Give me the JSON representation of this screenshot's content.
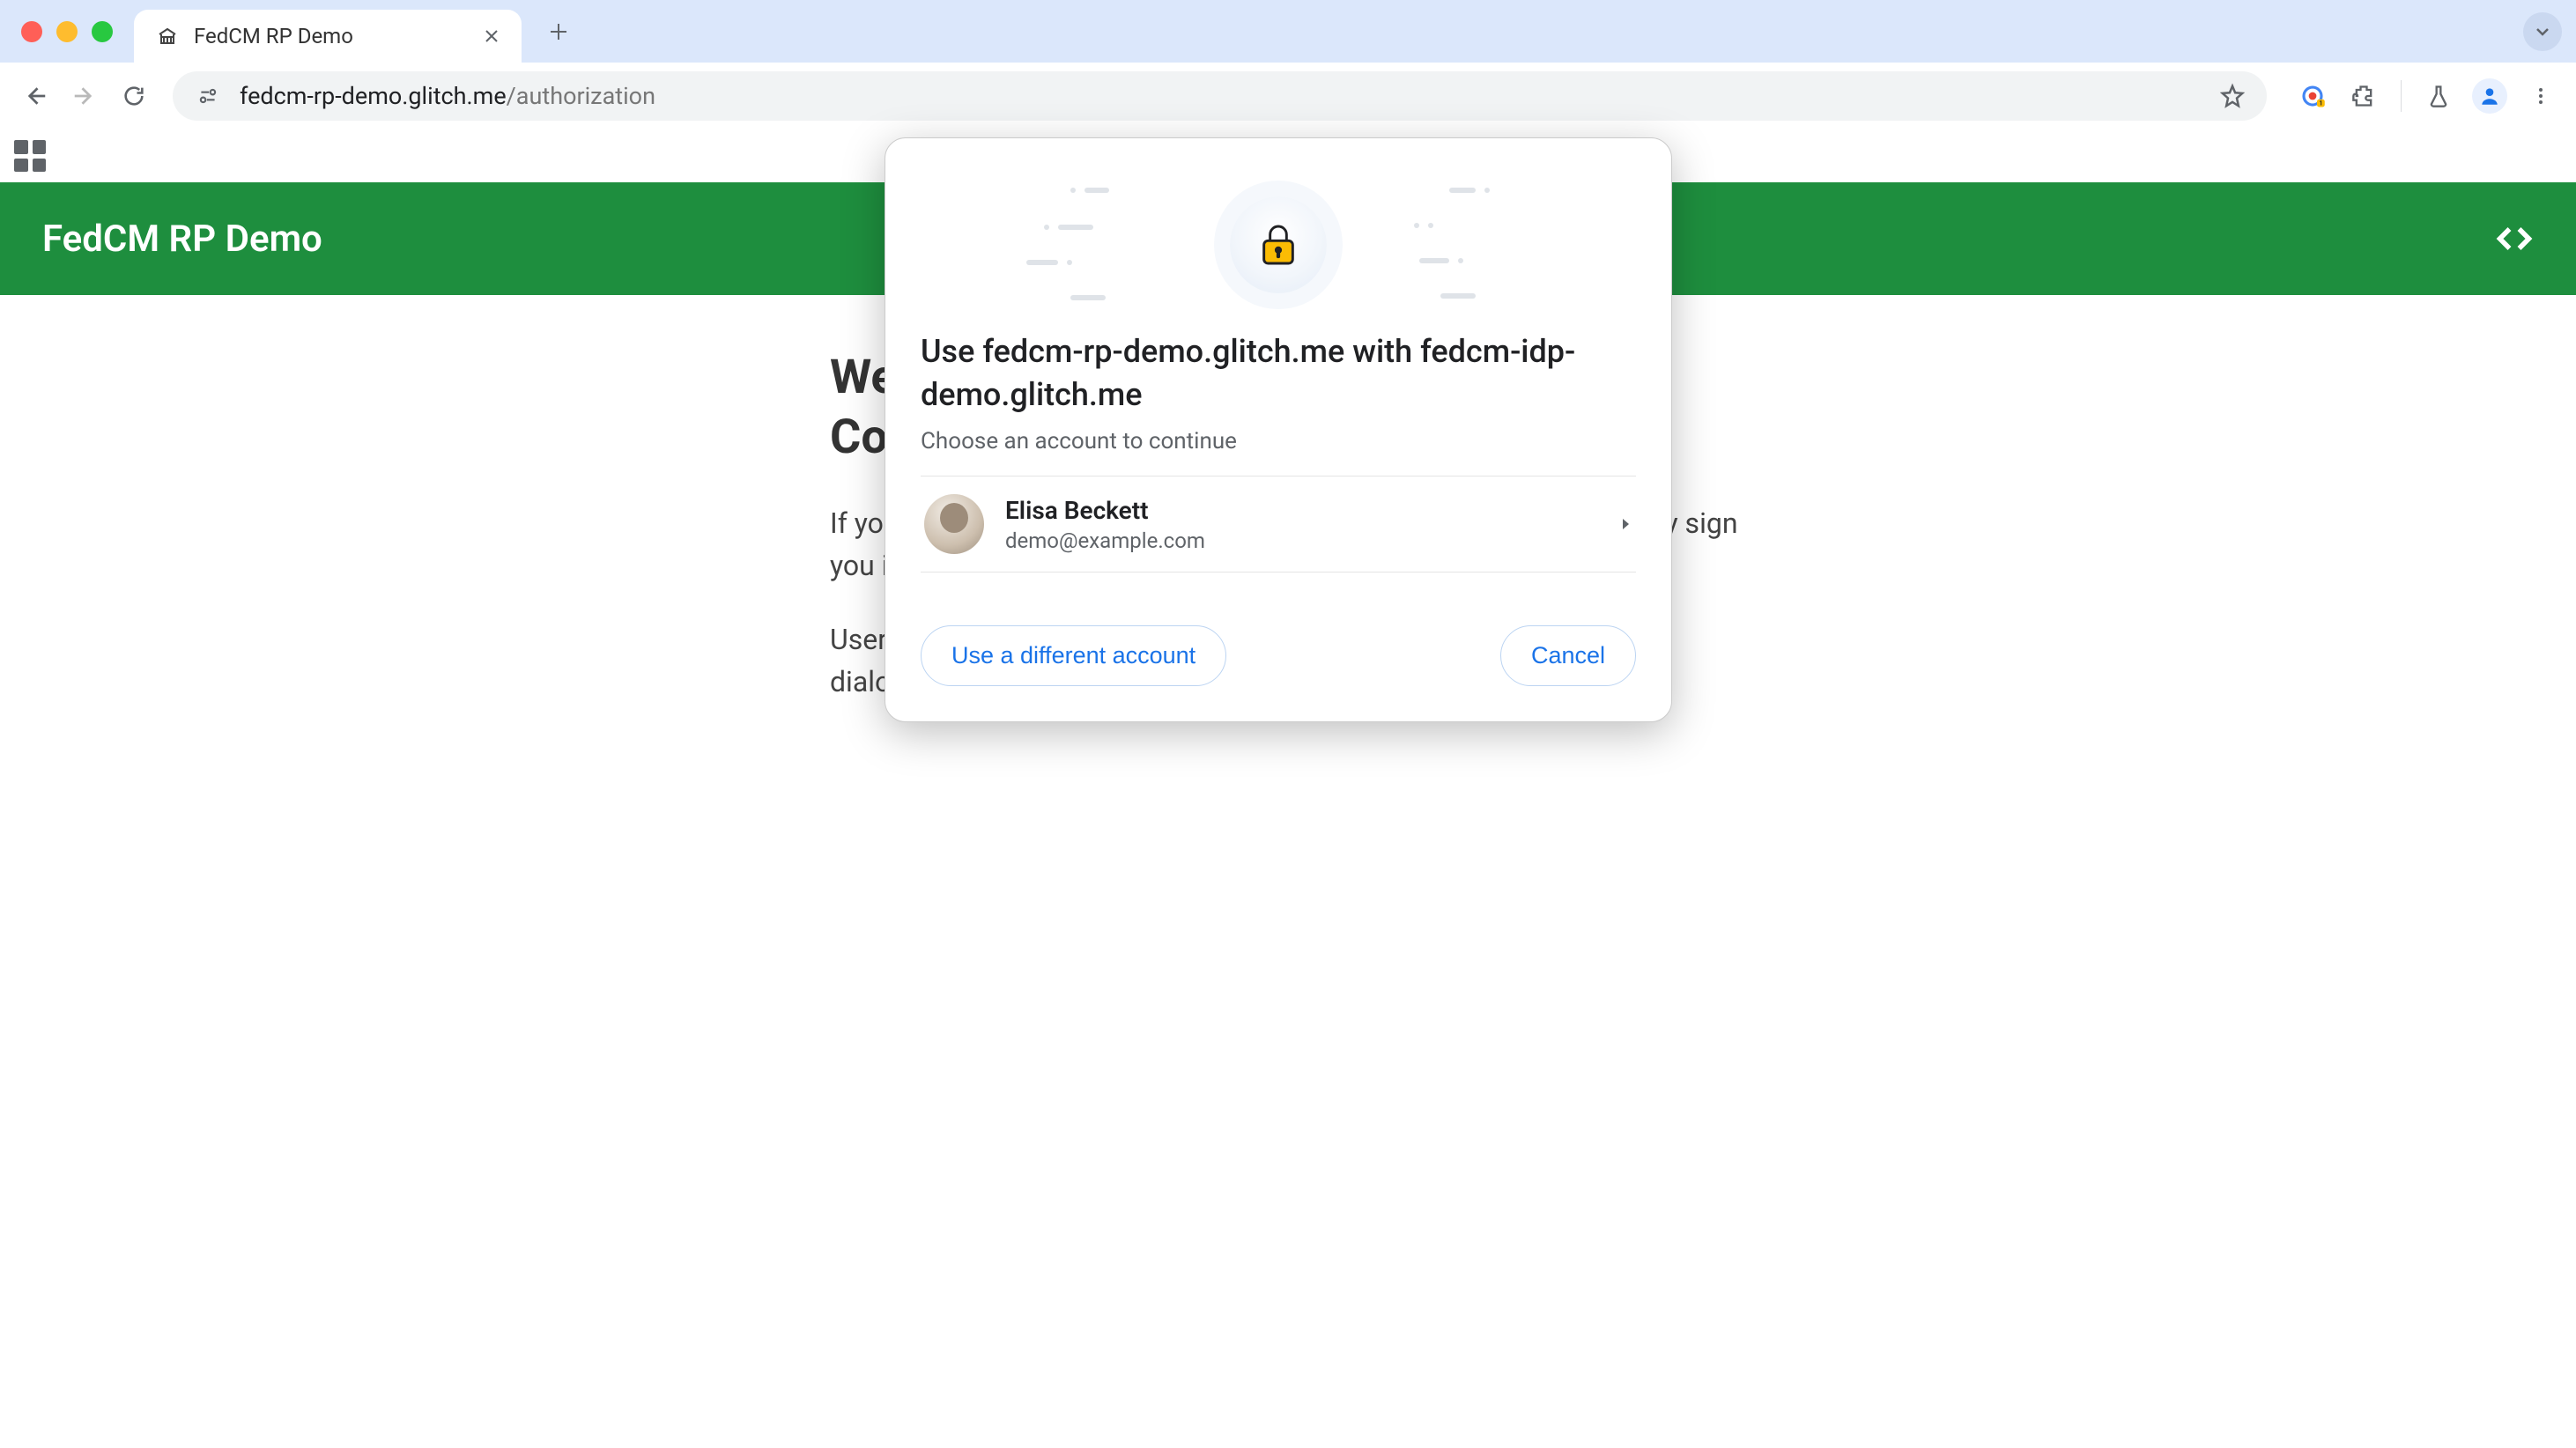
{
  "browser": {
    "tab_title": "FedCM RP Demo",
    "url_host": "fedcm-rp-demo.glitch.me",
    "url_path": "/authorization"
  },
  "page": {
    "header_title": "FedCM RP Demo",
    "heading_line1": "Welcome to FedCM RP Demo!",
    "heading_line2": "Continue with IdP",
    "para1": "If you already signed up on this site with IdP, this page automatically sign you in. Otherwise, sign-in on this page.",
    "para2": "User mediation is set to required. This causes the page to display a dialog."
  },
  "modal": {
    "title": "Use fedcm-rp-demo.glitch.me with fedcm-idp-demo.glitch.me",
    "subtitle": "Choose an account to continue",
    "account": {
      "name": "Elisa Beckett",
      "email": "demo@example.com"
    },
    "use_different": "Use a different account",
    "cancel": "Cancel"
  }
}
